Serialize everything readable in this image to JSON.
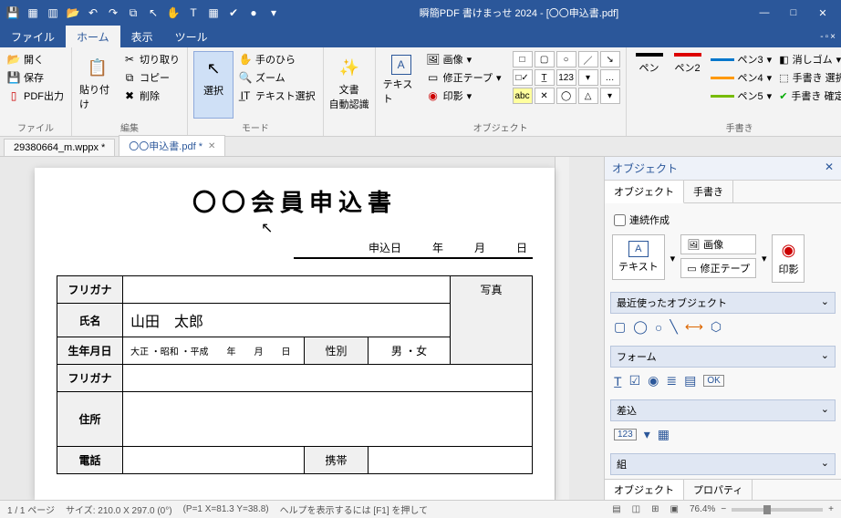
{
  "app": {
    "title": "瞬簡PDF 書けまっせ 2024 - [〇〇申込書.pdf]"
  },
  "menus": {
    "file": "ファイル",
    "home": "ホーム",
    "view": "表示",
    "tool": "ツール"
  },
  "ribbon": {
    "file": {
      "open": "開く",
      "save": "保存",
      "pdfout": "PDF出力",
      "label": "ファイル"
    },
    "edit": {
      "paste": "貼り付け",
      "cut": "切り取り",
      "copy": "コピー",
      "delete": "削除",
      "label": "編集"
    },
    "mode": {
      "select": "選択",
      "hand": "手のひら",
      "zoom": "ズーム",
      "textsel": "テキスト選択",
      "label": "モード"
    },
    "recog": {
      "btn": "文書\n自動認識"
    },
    "object": {
      "text": "テキスト",
      "image": "画像",
      "tape": "修正テープ",
      "stamp": "印影",
      "label": "オブジェクト"
    },
    "pens": {
      "pen": "ペン",
      "pen2": "ペン2",
      "pen3": "ペン3",
      "pen4": "ペン4",
      "pen5": "ペン5",
      "eraser": "消しゴム",
      "hand_sel": "手書き 選択",
      "hand_fix": "手書き 確定",
      "label": "手書き"
    }
  },
  "tabs": {
    "t1": "29380664_m.wppx *",
    "t2": "〇〇申込書.pdf *"
  },
  "doc": {
    "title": "〇〇会員申込書",
    "date_label": "申込日",
    "year": "年",
    "month": "月",
    "day": "日",
    "furigana": "フリガナ",
    "name_label": "氏名",
    "name_value": "山田　太郎",
    "birth_label": "生年月日",
    "era_text": "大正 ・昭和 ・平成　　年　　月　　日",
    "gender_label": "性別",
    "gender_value": "男 ・女",
    "photo": "写真",
    "address": "住所",
    "phone": "電話",
    "mobile": "携帯"
  },
  "side": {
    "title": "オブジェクト",
    "tab_obj": "オブジェクト",
    "tab_hand": "手書き",
    "cont": "連続作成",
    "text": "テキスト",
    "image": "画像",
    "tape": "修正テープ",
    "stamp": "印影",
    "recent": "最近使ったオブジェクト",
    "form": "フォーム",
    "merge": "差込",
    "more": "組",
    "bottom_obj": "オブジェクト",
    "bottom_prop": "プロパティ"
  },
  "status": {
    "page": "1 / 1 ページ",
    "size": "サイズ: 210.0 X 297.0 (0°)",
    "pos": "(P=1 X=81.3 Y=38.8)",
    "help": "ヘルプを表示するには [F1] を押して",
    "zoom": "76.4%"
  }
}
